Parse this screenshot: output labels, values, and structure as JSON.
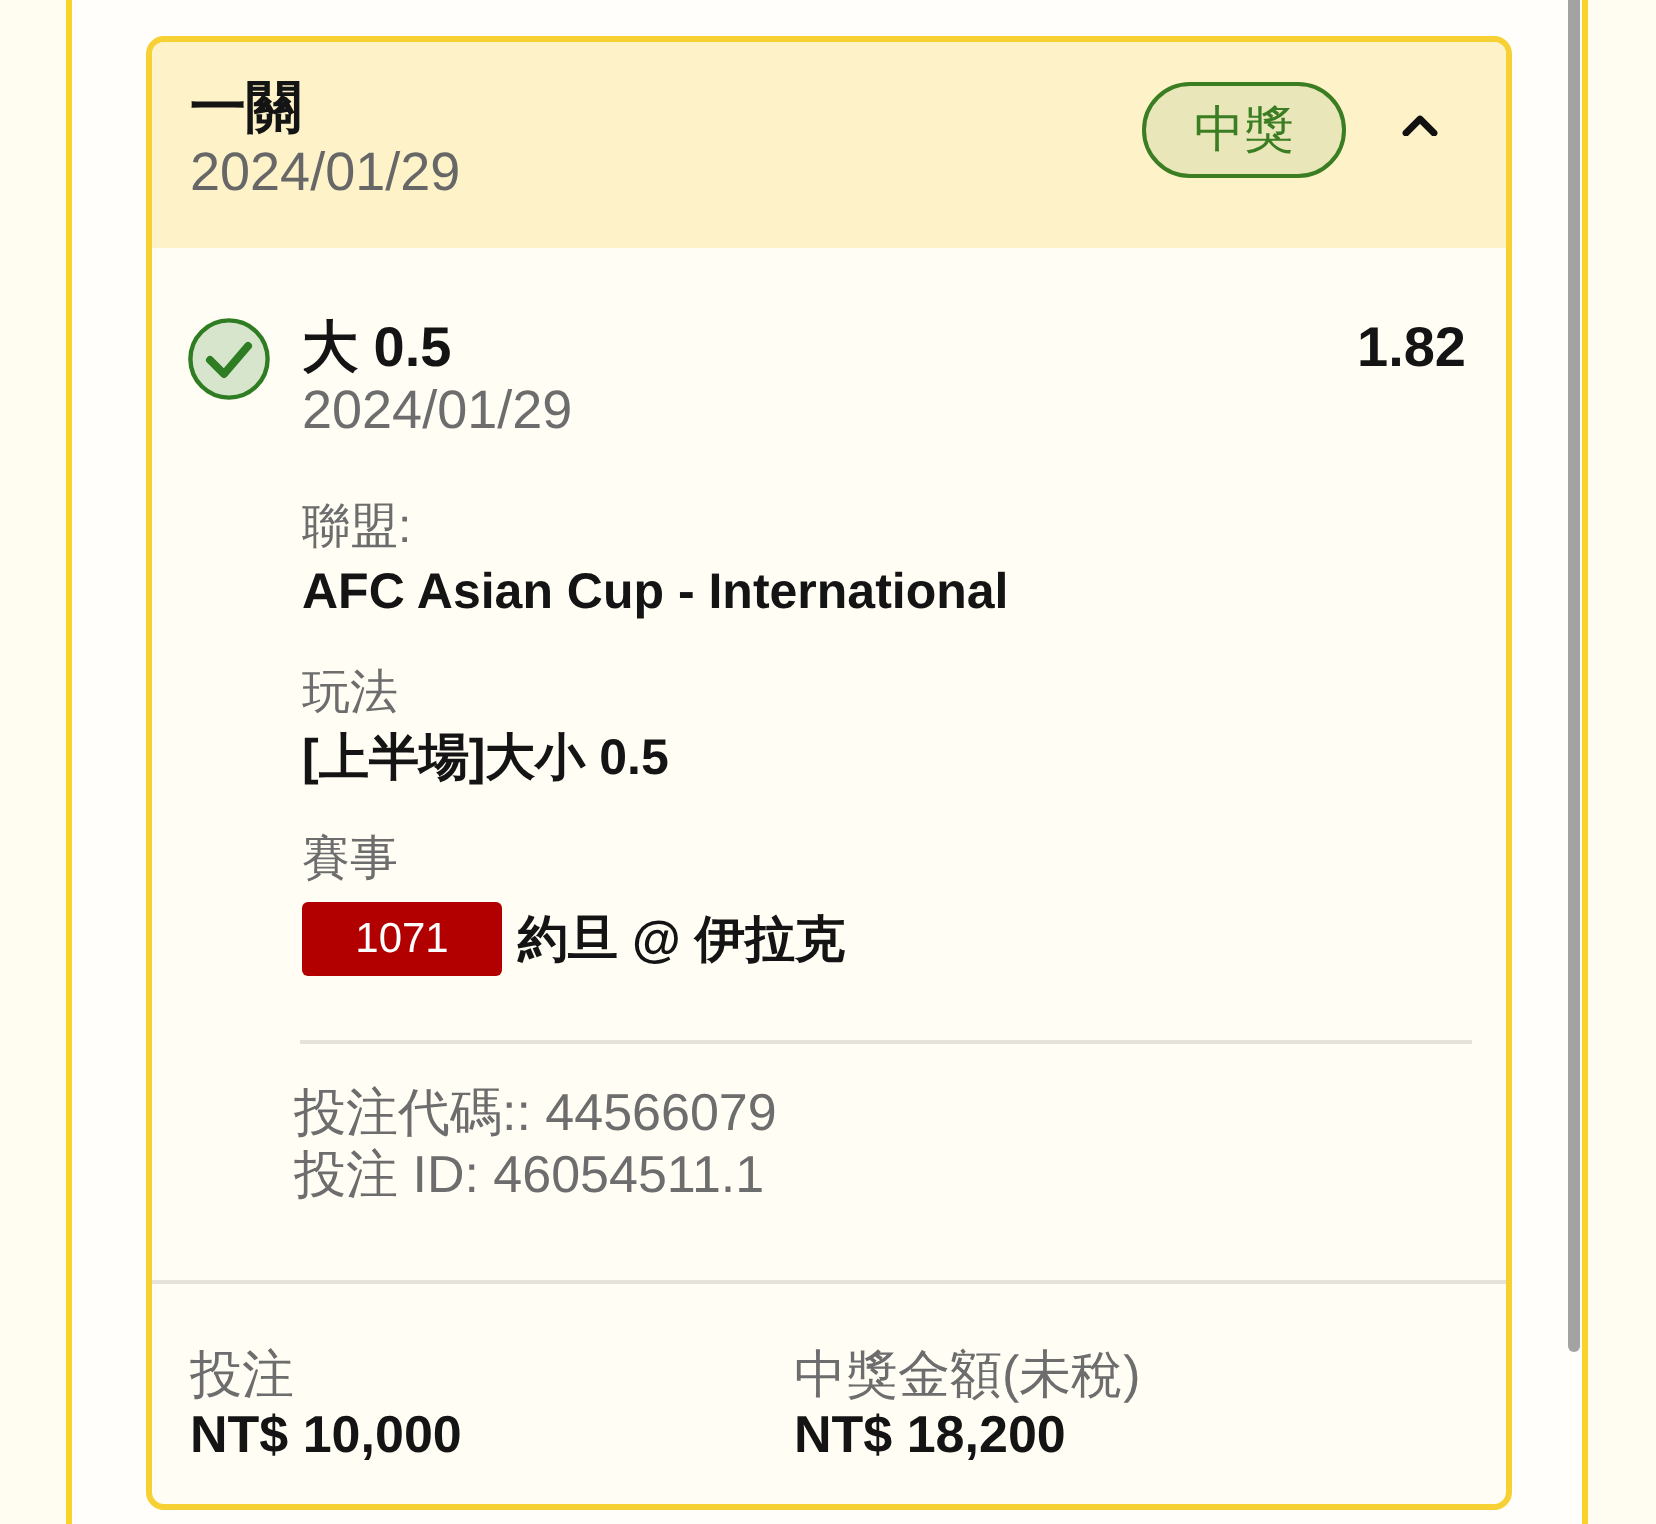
{
  "bet_card": {
    "header": {
      "title": "一關",
      "date": "2024/01/29",
      "status_badge": "中獎",
      "expanded": true
    },
    "selection": {
      "won": true,
      "pick": "大 0.5",
      "odds": "1.82",
      "date": "2024/01/29",
      "details": [
        {
          "kind": "text",
          "label": "聯盟:",
          "value": "AFC Asian Cup - International"
        },
        {
          "kind": "text",
          "label": "玩法",
          "value": "[上半場]大小 0.5"
        },
        {
          "kind": "match",
          "label": "賽事",
          "match_code": "1071",
          "value": "約旦 @ 伊拉克"
        }
      ]
    },
    "references": [
      "投注代碼:: 44566079",
      "投注 ID: 46054511.1"
    ],
    "footer": [
      {
        "label": "投注",
        "value": "NT$ 10,000"
      },
      {
        "label": "中獎金額(未稅)",
        "value": "NT$ 18,200"
      }
    ]
  }
}
